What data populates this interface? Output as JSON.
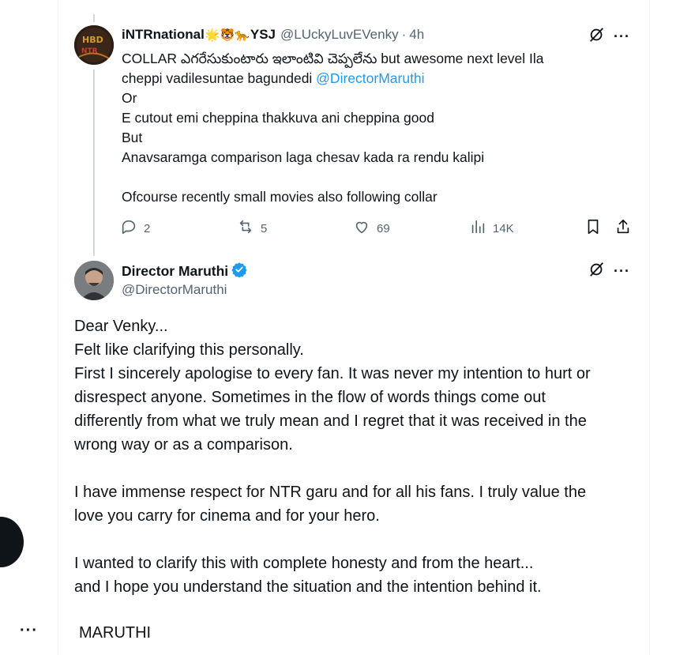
{
  "reply": {
    "name": "iNTRnational",
    "emoji": "🌟🐯🐆",
    "name_suffix": "YSJ",
    "handle": "@LUckyLuvEVenky",
    "dot": "·",
    "time": "4h",
    "lines": [
      "COLLAR ఎగరేసుకుంటారు ఇలాంటివి చెప్పలేను but awesome next level Ila",
      "cheppi vadilesuntae bagundedi ",
      "Or",
      "E cutout emi cheppina thakkuva ani cheppina good",
      "But",
      "Anavsaramga comparison laga chesav kada ra rendu kalipi",
      "",
      "Ofcourse recently small movies also following collar"
    ],
    "mention": "@DirectorMaruthi",
    "actions": {
      "replies": "2",
      "reposts": "5",
      "likes": "69",
      "views": "14K"
    }
  },
  "main": {
    "name": "Director Maruthi",
    "handle": "@DirectorMaruthi",
    "lines": [
      "Dear Venky...",
      "Felt like clarifying this personally.",
      "First I sincerely apologise to every fan. It was never my intention to hurt or",
      "disrespect anyone. Sometimes in the flow of words things come out",
      "differently from what we truly mean and I regret that it was received in the",
      "wrong way or as a comparison.",
      "",
      "I have immense respect for NTR garu and for all his fans. I truly value the",
      "love you carry for cinema and for your hero.",
      "",
      "I wanted to clarify this with complete honesty and from the heart...",
      "and I hope you understand the situation and the intention behind it."
    ],
    "signature": "MARUTHI"
  },
  "menu_dots": "···",
  "side_dots": "···",
  "colors": {
    "accent": "#1d9bf0",
    "text": "#0f1419",
    "muted": "#536471",
    "border": "#eff3f4"
  }
}
